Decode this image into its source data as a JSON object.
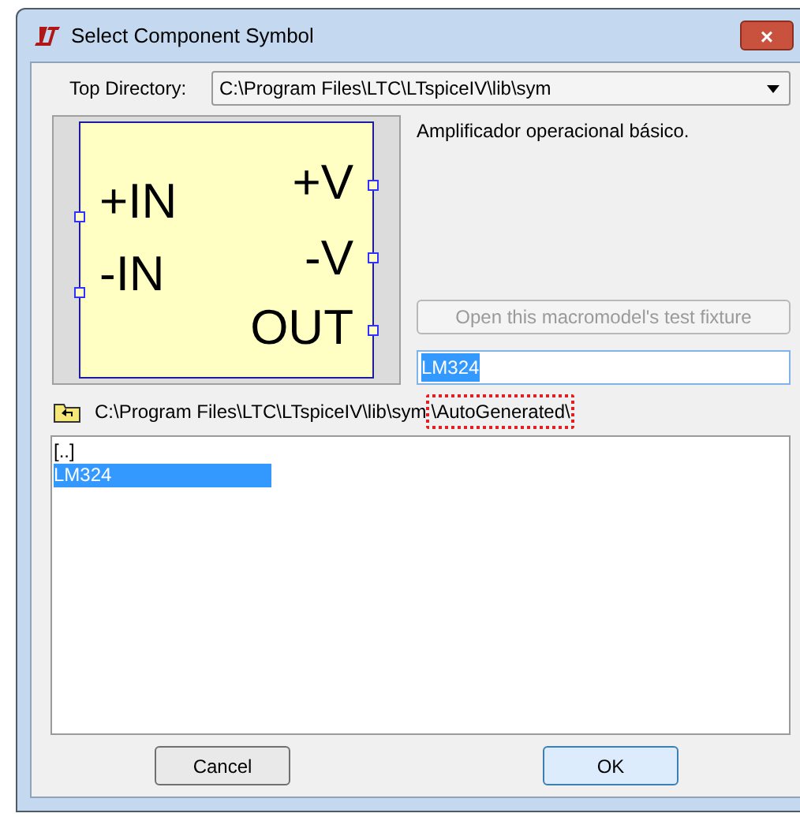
{
  "window": {
    "title": "Select Component Symbol",
    "close": "×"
  },
  "top_directory": {
    "label": "Top Directory:",
    "value": "C:\\Program Files\\LTC\\LTspiceIV\\lib\\sym"
  },
  "symbol": {
    "left_pins": [
      "+IN",
      "-IN"
    ],
    "right_pins": [
      "+V",
      "-V",
      "OUT"
    ]
  },
  "description": "Amplificador operacional básico.",
  "test_fixture_button": {
    "label": "Open this macromodel's test fixture",
    "disabled": true
  },
  "name_field": {
    "value": "LM324",
    "selected": true
  },
  "path": {
    "base": "C:\\Program Files\\LTC\\LTspiceIV\\lib\\sym",
    "highlighted": "\\AutoGenerated\\"
  },
  "files": [
    {
      "label": "[..]",
      "selected": false
    },
    {
      "label": "LM324",
      "selected": true
    }
  ],
  "buttons": [
    {
      "label": "Cancel",
      "default": false
    },
    {
      "label": "OK",
      "default": true
    }
  ]
}
